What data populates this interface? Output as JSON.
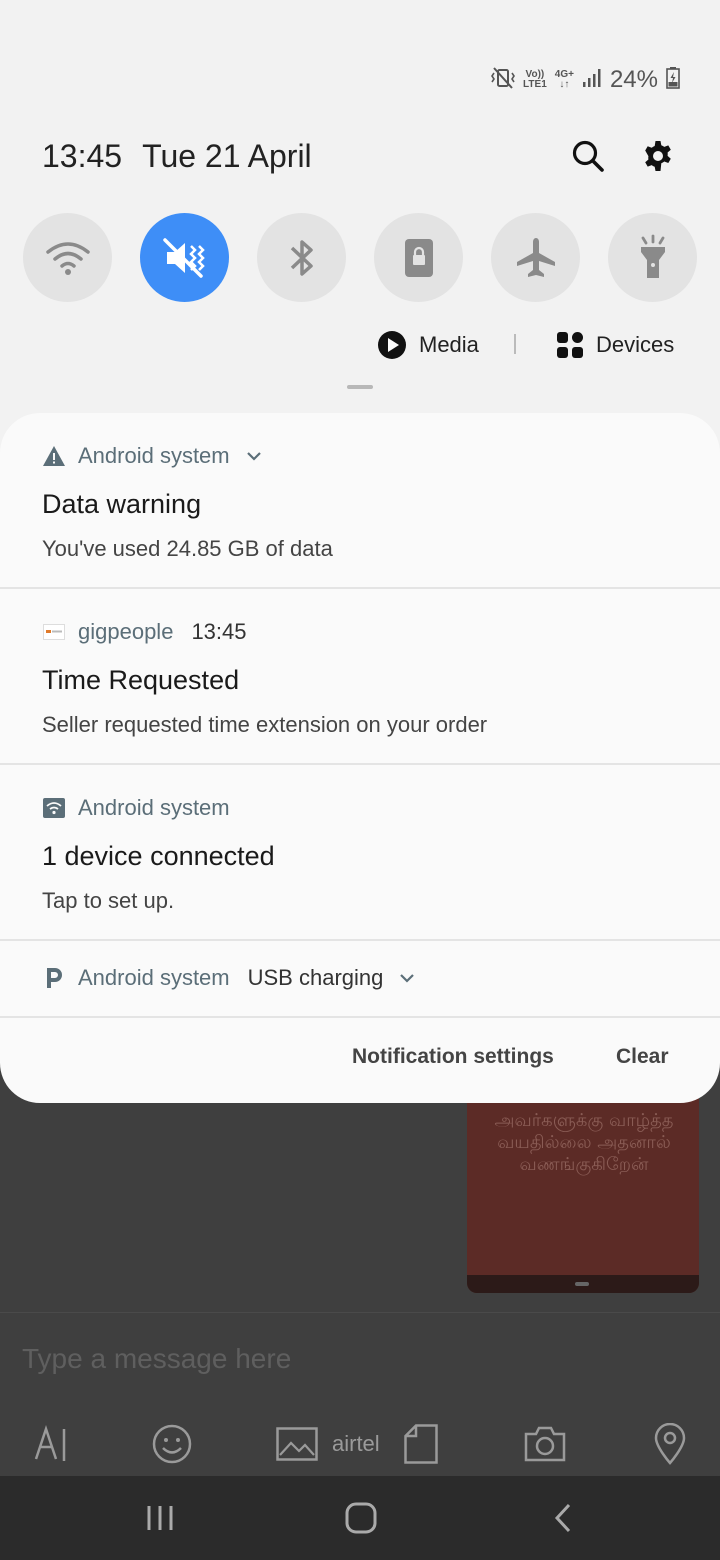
{
  "status_bar": {
    "volte_label": "Vo))",
    "lte_label": "LTE1",
    "network_label": "4G+",
    "battery_percent": "24%"
  },
  "header": {
    "time": "13:45",
    "date": "Tue 21 April"
  },
  "quick_toggles": [
    {
      "name": "wifi",
      "active": false
    },
    {
      "name": "vibrate",
      "active": true
    },
    {
      "name": "bluetooth",
      "active": false
    },
    {
      "name": "portrait-lock",
      "active": false
    },
    {
      "name": "airplane",
      "active": false
    },
    {
      "name": "flashlight",
      "active": false
    }
  ],
  "media_devices": {
    "media_label": "Media",
    "devices_label": "Devices"
  },
  "notifications": [
    {
      "app": "Android system",
      "title": "Data warning",
      "text": "You've used 24.85 GB of data"
    },
    {
      "app": "gigpeople",
      "time": "13:45",
      "title": "Time Requested",
      "text": "Seller requested time extension on your order"
    },
    {
      "app": "Android system",
      "title": "1 device connected",
      "text": "Tap to set up."
    },
    {
      "app": "Android system",
      "summary": "USB charging"
    }
  ],
  "card_actions": {
    "settings_label": "Notification settings",
    "clear_label": "Clear"
  },
  "background_app": {
    "image_text": "அவர்களுக்கு வாழ்த்த வயதில்லை அதனால் வணங்குகிறேன்",
    "message_placeholder": "Type a message here",
    "carrier_label": "airtel"
  },
  "colors": {
    "accent": "#3e8ef7",
    "panel_bg": "#f2f2f2",
    "card_bg": "#fafafa",
    "app_name": "#5b6e78"
  }
}
